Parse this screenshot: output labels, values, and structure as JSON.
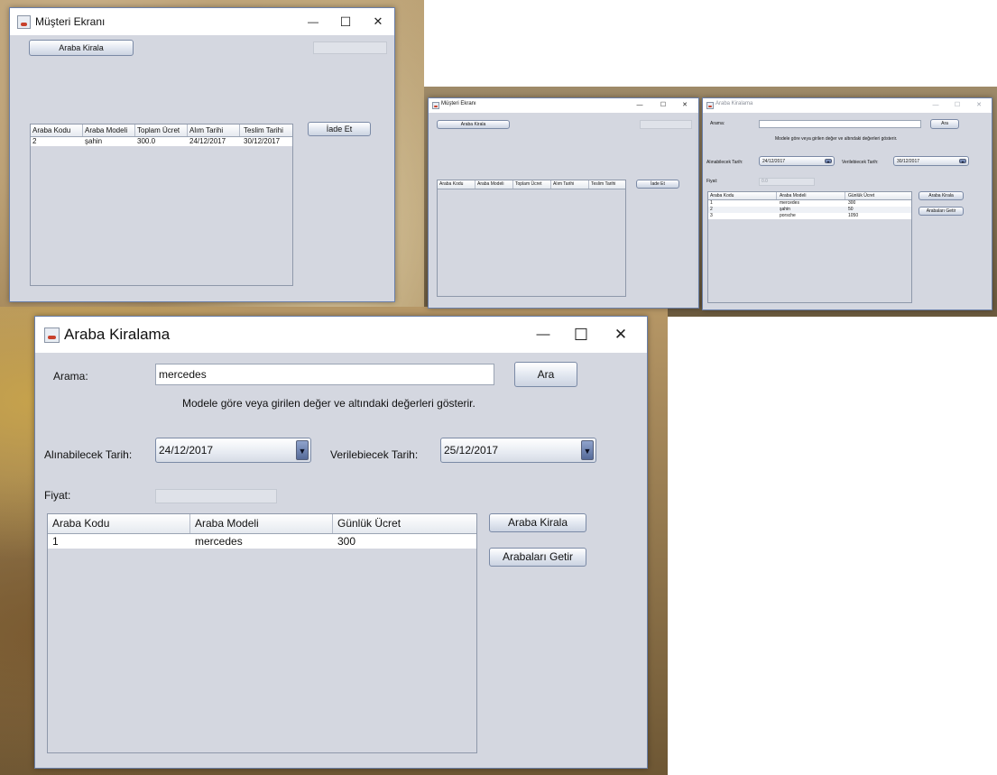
{
  "customer_window": {
    "title": "Müşteri Ekranı",
    "rent_button": "Araba Kirala",
    "return_button": "İade Et",
    "columns": [
      "Araba Kodu",
      "Araba Modeli",
      "Toplam Ücret",
      "Alım Tarihi",
      "Teslim Tarihi"
    ],
    "rows": [
      [
        "2",
        "şahin",
        "300.0",
        "24/12/2017",
        "30/12/2017"
      ]
    ]
  },
  "customer_window_small": {
    "title": "Müşteri Ekranı",
    "rent_button": "Araba Kirala",
    "return_button": "İade Et",
    "columns": [
      "Araba Kodu",
      "Araba Modeli",
      "Toplam Ücret",
      "Alım Tarihi",
      "Teslim Tarihi"
    ]
  },
  "rental_window_small": {
    "title": "Araba Kiralama",
    "search_label": "Arama:",
    "search_value": "",
    "search_button": "Ara",
    "hint": "Modele göre veya girilen değer ve altındaki değerleri gösterir.",
    "from_label": "Alınabilecek Tarih:",
    "from_value": "24/12/2017",
    "to_label": "Verilebiecek Tarih:",
    "to_value": "30/12/2017",
    "price_label": "Fiyat:",
    "price_value": "0.0",
    "rent_button": "Araba Kirala",
    "fetch_button": "Arabaları Getir",
    "columns": [
      "Araba Kodu",
      "Araba Modeli",
      "Günlük Ücret"
    ],
    "rows": [
      [
        "1",
        "mercedes",
        "300"
      ],
      [
        "2",
        "şahin",
        "50"
      ],
      [
        "3",
        "porsche",
        "1050"
      ]
    ]
  },
  "rental_window": {
    "title": "Araba Kiralama",
    "search_label": "Arama:",
    "search_value": "mercedes",
    "search_button": "Ara",
    "hint": "Modele göre veya girilen değer ve altındaki değerleri gösterir.",
    "from_label": "Alınabilecek Tarih:",
    "from_value": "24/12/2017",
    "to_label": "Verilebiecek Tarih:",
    "to_value": "25/12/2017",
    "price_label": "Fiyat:",
    "price_value": "",
    "rent_button": "Araba Kirala",
    "fetch_button": "Arabaları Getir",
    "columns": [
      "Araba Kodu",
      "Araba Modeli",
      "Günlük Ücret"
    ],
    "rows": [
      [
        "1",
        "mercedes",
        "300"
      ]
    ]
  },
  "window_controls": {
    "minimize": "—",
    "maximize": "☐",
    "close": "✕",
    "dropdown_arrow": "▼"
  }
}
